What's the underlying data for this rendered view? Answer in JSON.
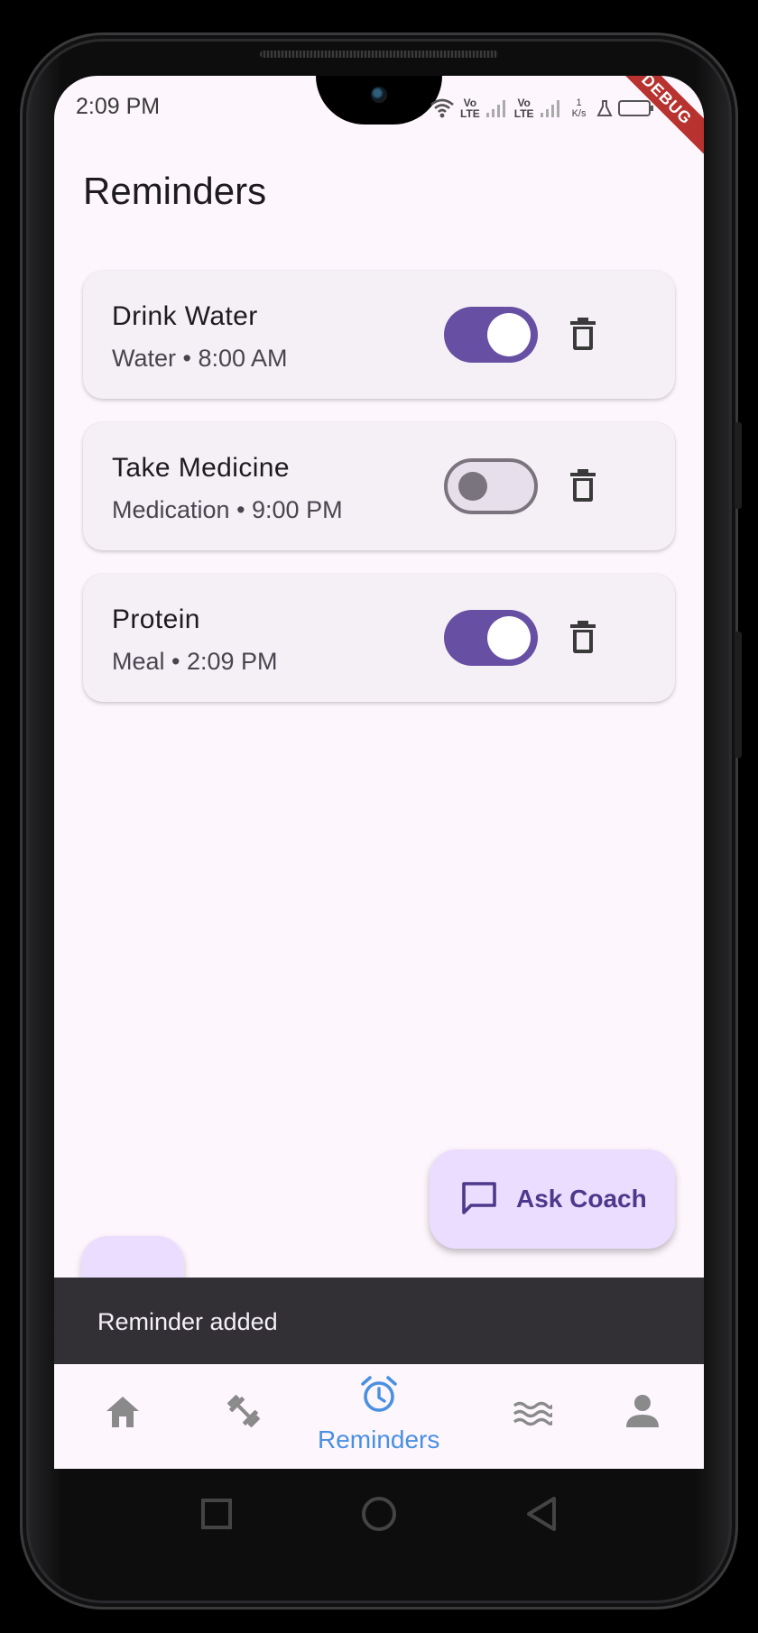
{
  "status_bar": {
    "time": "2:09 PM",
    "network_1": "Vo\nLTE",
    "network_2": "Vo\nLTE",
    "speed_value": "1",
    "speed_unit": "K/s",
    "debug_banner": "DEBUG"
  },
  "page": {
    "title": "Reminders"
  },
  "reminders": [
    {
      "title": "Drink Water",
      "subtitle": "Water • 8:00 AM",
      "enabled": true
    },
    {
      "title": "Take Medicine",
      "subtitle": "Medication • 9:00 PM",
      "enabled": false
    },
    {
      "title": "Protein",
      "subtitle": "Meal • 2:09 PM",
      "enabled": true
    }
  ],
  "fab": {
    "ask_coach_label": "Ask Coach",
    "add_label": "+"
  },
  "snackbar": {
    "message": "Reminder added"
  },
  "bottom_nav": {
    "items": [
      {
        "id": "home",
        "icon": "home-icon",
        "label": "",
        "selected": false
      },
      {
        "id": "workouts",
        "icon": "dumbbell-icon",
        "label": "",
        "selected": false
      },
      {
        "id": "reminders",
        "icon": "alarm-clock-icon",
        "label": "Reminders",
        "selected": true
      },
      {
        "id": "water",
        "icon": "waves-icon",
        "label": "",
        "selected": false
      },
      {
        "id": "profile",
        "icon": "person-icon",
        "label": "",
        "selected": false
      }
    ]
  },
  "colors": {
    "accent": "#6750a4",
    "selected_nav": "#4a90e2",
    "background": "#fdf6fd",
    "fab": "#eaddff",
    "snackbar": "#322f35"
  }
}
